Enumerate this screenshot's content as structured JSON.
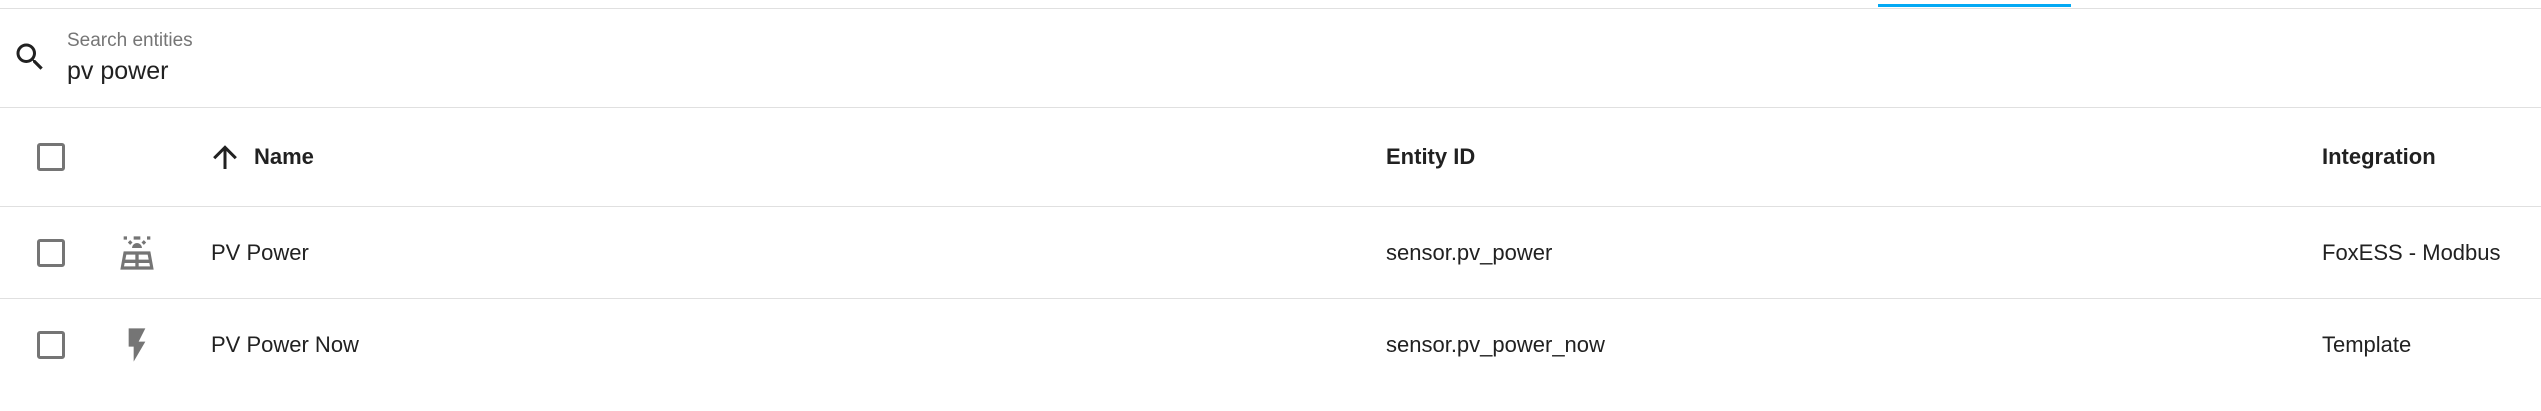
{
  "search": {
    "label": "Search entities",
    "value": "pv power"
  },
  "table": {
    "headers": {
      "name": "Name",
      "entity_id": "Entity ID",
      "integration": "Integration"
    },
    "sort": {
      "column": "name",
      "direction": "ascending"
    },
    "rows": [
      {
        "icon": "solar-panel-icon",
        "name": "PV Power",
        "entity_id": "sensor.pv_power",
        "integration": "FoxESS - Modbus"
      },
      {
        "icon": "flash-icon",
        "name": "PV Power Now",
        "entity_id": "sensor.pv_power_now",
        "integration": "Template"
      }
    ]
  },
  "colors": {
    "accent": "#03a9f4",
    "icon": "#757575",
    "divider": "#e0e0e0"
  }
}
